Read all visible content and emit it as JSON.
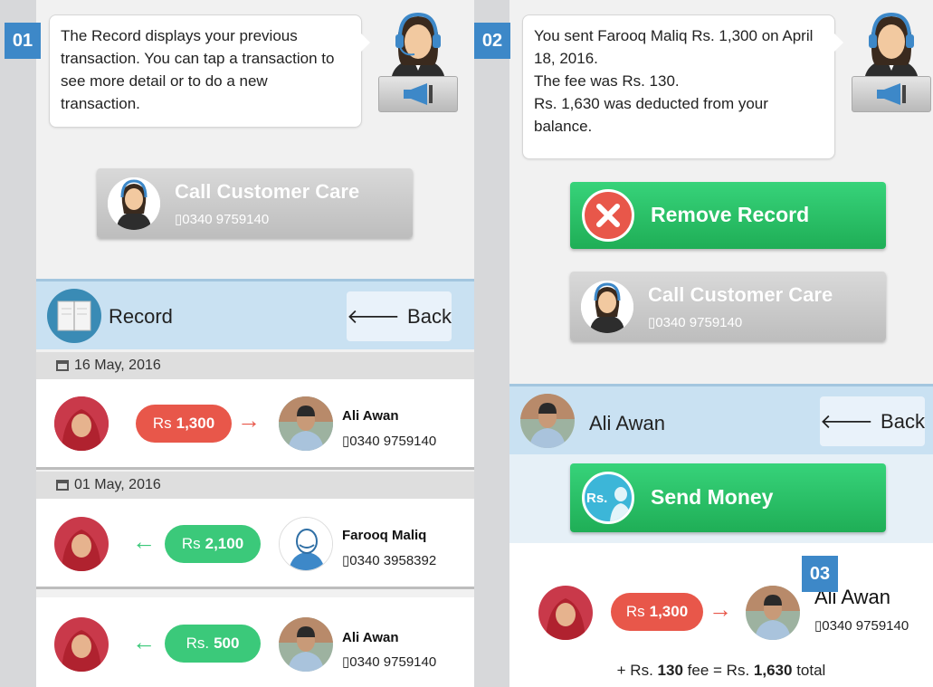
{
  "steps": [
    "01",
    "02",
    "03"
  ],
  "screen1": {
    "bubble_text": "The Record displays your previous transaction. You can tap a transaction to see more detail or to do a new transaction.",
    "call_care": {
      "label": "Call Customer Care",
      "phone": "0340 9759140"
    },
    "header": {
      "title": "Record",
      "back_label": "Back"
    },
    "groups": [
      {
        "date": "16 May, 2016",
        "rows": [
          {
            "direction": "out",
            "currency": "Rs",
            "amount": "1,300",
            "name": "Ali Awan",
            "phone": "0340 9759140"
          }
        ]
      },
      {
        "date": "01 May, 2016",
        "rows": [
          {
            "direction": "in",
            "currency": "Rs",
            "amount": "2,100",
            "name": "Farooq Maliq",
            "phone": "0340 3958392"
          },
          {
            "direction": "in",
            "currency": "Rs.",
            "amount": "500",
            "name": "Ali Awan",
            "phone": "0340 9759140"
          }
        ]
      }
    ]
  },
  "screen2": {
    "bubble_lines": [
      "You sent Farooq Maliq Rs. 1,300 on April 18, 2016.",
      "The fee was Rs. 130.",
      "Rs. 1,630 was deducted from your balance."
    ],
    "remove_label": "Remove Record",
    "call_care": {
      "label": "Call Customer Care",
      "phone": "0340 9759140"
    },
    "header": {
      "title": "Ali Awan",
      "back_label": "Back"
    },
    "send_label": "Send Money",
    "send_icon_text": "Rs.",
    "detail": {
      "currency": "Rs",
      "amount": "1,300",
      "name": "Ali Awan",
      "phone": "0340 9759140",
      "fee_prefix": "+ Rs.",
      "fee": "130",
      "fee_mid": "fee = Rs.",
      "total": "1,630",
      "total_suffix": "total"
    }
  },
  "colors": {
    "accent_blue": "#3d88c8",
    "red": "#e8574a",
    "green": "#3bc97a",
    "header_blue": "#c9e1f2"
  }
}
